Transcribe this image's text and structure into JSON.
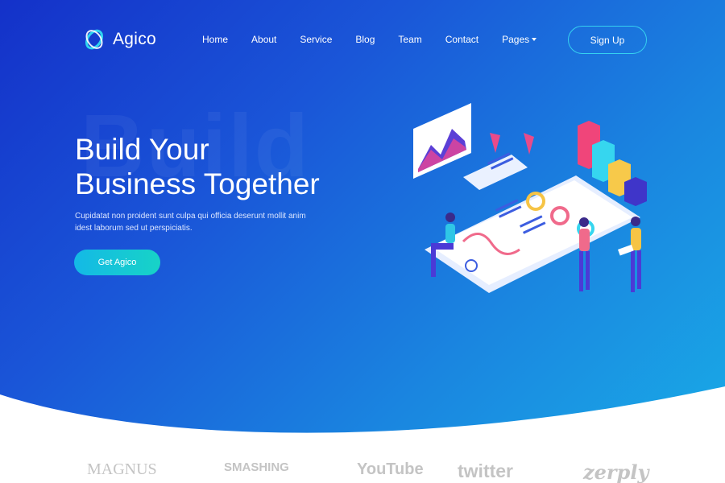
{
  "brand": {
    "name": "Agico"
  },
  "nav": {
    "items": [
      {
        "label": "Home"
      },
      {
        "label": "About"
      },
      {
        "label": "Service"
      },
      {
        "label": "Blog"
      },
      {
        "label": "Team"
      },
      {
        "label": "Contact"
      },
      {
        "label": "Pages"
      }
    ],
    "signup_label": "Sign Up"
  },
  "hero": {
    "background_word": "Build",
    "headline_line1": "Build Your",
    "headline_line2": "Business Together",
    "subtext": "Cupidatat non proident sunt culpa qui officia deserunt mollit anim idest laborum sed ut perspiciatis.",
    "cta_label": "Get Agico"
  },
  "partners": {
    "logos": [
      "MAGNUS",
      "SMASHING",
      "YouTube",
      "twitter",
      "zerply"
    ]
  },
  "colors": {
    "hero_start": "#1431c9",
    "hero_end": "#19a9e6",
    "accent": "#17d3c7",
    "signup_border": "#35d1f0"
  }
}
